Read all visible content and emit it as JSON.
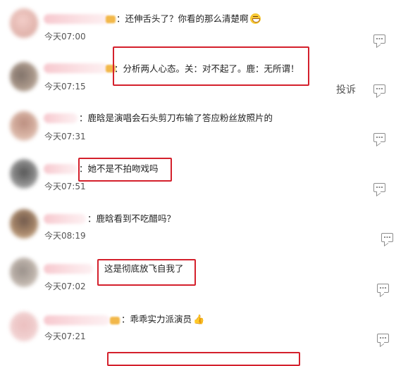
{
  "comments": [
    {
      "text": "：还伸舌头了？你看的那么清楚啊",
      "emoji": "grin-emoji",
      "time": "今天07:00",
      "colors": [
        "#f2c6c0",
        "#d9a39a"
      ]
    },
    {
      "text": "：分析两人心态。关：对不起了。鹿：无所谓！",
      "time": "今天07:15",
      "report_label": "投诉",
      "colors": [
        "#6b5a50",
        "#c9b8a8"
      ]
    },
    {
      "text": "：鹿晗是演唱会石头剪刀布输了答应粉丝放照片的",
      "time": "今天07:31",
      "colors": [
        "#b07b6a",
        "#e8cfc4"
      ]
    },
    {
      "text": "：她不是不拍吻戏吗",
      "time": "今天07:51",
      "colors": [
        "#3a3a3a",
        "#c8c8c8"
      ]
    },
    {
      "text": "：鹿晗看到不吃醋吗？",
      "time": "今天08:19",
      "colors": [
        "#5a3e2e",
        "#d7b48a"
      ]
    },
    {
      "text": "这是彻底放飞自我了",
      "time": "今天07:02",
      "colors": [
        "#8a7f78",
        "#d9cfc6"
      ]
    },
    {
      "text": "：乖乖实力派演员",
      "emoji": "thumbs-up-emoji",
      "time": "今天07:21",
      "colors": [
        "#e8b4b4",
        "#f3d6d6"
      ]
    }
  ],
  "accent_colors": {
    "highlight_box": "#d4202c",
    "icon_gray": "#8c8c8c"
  }
}
